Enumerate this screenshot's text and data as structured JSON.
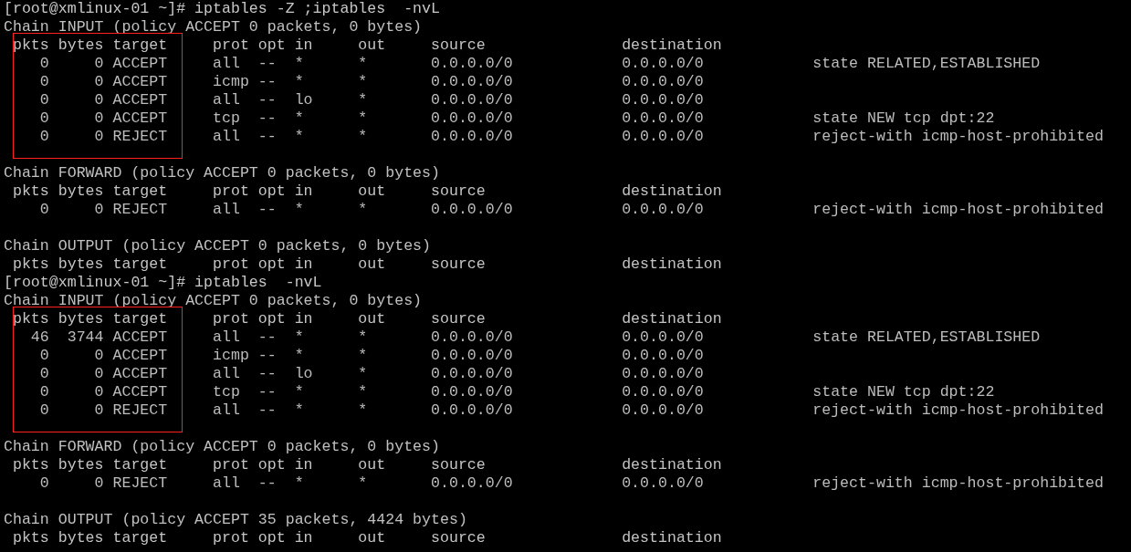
{
  "terminal": {
    "lines": [
      {
        "kind": "prompt",
        "text": "[root@xmlinux-01 ~]# iptables -Z ;iptables  -nvL",
        "highlighted": false
      },
      {
        "kind": "chain",
        "text": "Chain INPUT (policy ACCEPT 0 packets, 0 bytes)",
        "highlighted": false
      },
      {
        "kind": "header",
        "text": " pkts bytes target     prot opt in     out     source               destination",
        "highlighted": true
      },
      {
        "kind": "row",
        "text": "    0     0 ACCEPT     all  --  *      *       0.0.0.0/0            0.0.0.0/0            state RELATED,ESTABLISHED",
        "highlighted": true
      },
      {
        "kind": "row",
        "text": "    0     0 ACCEPT     icmp --  *      *       0.0.0.0/0            0.0.0.0/0",
        "highlighted": true
      },
      {
        "kind": "row",
        "text": "    0     0 ACCEPT     all  --  lo     *       0.0.0.0/0            0.0.0.0/0",
        "highlighted": true
      },
      {
        "kind": "row",
        "text": "    0     0 ACCEPT     tcp  --  *      *       0.0.0.0/0            0.0.0.0/0            state NEW tcp dpt:22",
        "highlighted": true
      },
      {
        "kind": "row",
        "text": "    0     0 REJECT     all  --  *      *       0.0.0.0/0            0.0.0.0/0            reject-with icmp-host-prohibited",
        "highlighted": true
      },
      {
        "kind": "blank"
      },
      {
        "kind": "chain",
        "text": "Chain FORWARD (policy ACCEPT 0 packets, 0 bytes)",
        "highlighted": false
      },
      {
        "kind": "header",
        "text": " pkts bytes target     prot opt in     out     source               destination",
        "highlighted": false
      },
      {
        "kind": "row",
        "text": "    0     0 REJECT     all  --  *      *       0.0.0.0/0            0.0.0.0/0            reject-with icmp-host-prohibited",
        "highlighted": false
      },
      {
        "kind": "blank"
      },
      {
        "kind": "chain",
        "text": "Chain OUTPUT (policy ACCEPT 0 packets, 0 bytes)",
        "highlighted": false
      },
      {
        "kind": "header",
        "text": " pkts bytes target     prot opt in     out     source               destination",
        "highlighted": false
      },
      {
        "kind": "prompt",
        "text": "[root@xmlinux-01 ~]# iptables  -nvL",
        "highlighted": false
      },
      {
        "kind": "chain",
        "text": "Chain INPUT (policy ACCEPT 0 packets, 0 bytes)",
        "highlighted": false
      },
      {
        "kind": "header",
        "text": " pkts bytes target     prot opt in     out     source               destination",
        "highlighted": true
      },
      {
        "kind": "row",
        "text": "   46  3744 ACCEPT     all  --  *      *       0.0.0.0/0            0.0.0.0/0            state RELATED,ESTABLISHED",
        "highlighted": true
      },
      {
        "kind": "row",
        "text": "    0     0 ACCEPT     icmp --  *      *       0.0.0.0/0            0.0.0.0/0",
        "highlighted": true
      },
      {
        "kind": "row",
        "text": "    0     0 ACCEPT     all  --  lo     *       0.0.0.0/0            0.0.0.0/0",
        "highlighted": true
      },
      {
        "kind": "row",
        "text": "    0     0 ACCEPT     tcp  --  *      *       0.0.0.0/0            0.0.0.0/0            state NEW tcp dpt:22",
        "highlighted": true
      },
      {
        "kind": "row",
        "text": "    0     0 REJECT     all  --  *      *       0.0.0.0/0            0.0.0.0/0            reject-with icmp-host-prohibited",
        "highlighted": true
      },
      {
        "kind": "blank"
      },
      {
        "kind": "chain",
        "text": "Chain FORWARD (policy ACCEPT 0 packets, 0 bytes)",
        "highlighted": false
      },
      {
        "kind": "header",
        "text": " pkts bytes target     prot opt in     out     source               destination",
        "highlighted": false
      },
      {
        "kind": "row",
        "text": "    0     0 REJECT     all  --  *      *       0.0.0.0/0            0.0.0.0/0            reject-with icmp-host-prohibited",
        "highlighted": false
      },
      {
        "kind": "blank"
      },
      {
        "kind": "chain",
        "text": "Chain OUTPUT (policy ACCEPT 35 packets, 4424 bytes)",
        "highlighted": false
      },
      {
        "kind": "header",
        "text": " pkts bytes target     prot opt in     out     source               destination",
        "highlighted": false
      }
    ]
  }
}
